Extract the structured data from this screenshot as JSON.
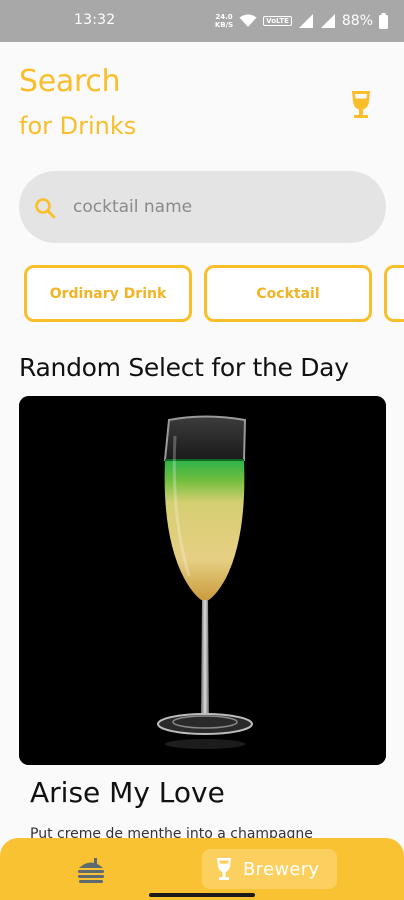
{
  "status_bar": {
    "time": "13:32",
    "net_speed_value": "24.0",
    "net_speed_unit": "KB/S",
    "volte": "VoLTE",
    "battery": "88%"
  },
  "header": {
    "title": "Search",
    "subtitle": "for Drinks",
    "icon": "wine-glass-icon"
  },
  "search": {
    "placeholder": "cocktail name",
    "value": "",
    "icon": "search-icon"
  },
  "categories": [
    {
      "label": "Ordinary Drink"
    },
    {
      "label": "Cocktail"
    },
    {
      "label": ""
    }
  ],
  "random_select": {
    "section_title": "Random Select for the Day",
    "drink_name": "Arise My Love",
    "instructions": "Put creme de menthe into a champagne"
  },
  "bottom_nav": {
    "food_icon": "burger-icon",
    "brewery_icon": "wine-glass-icon",
    "brewery_label": "Brewery"
  },
  "colors": {
    "accent": "#f9be2a",
    "nav_background": "#f9c233",
    "search_background": "#e4e4e4",
    "status_bar": "#a8a8a8"
  }
}
